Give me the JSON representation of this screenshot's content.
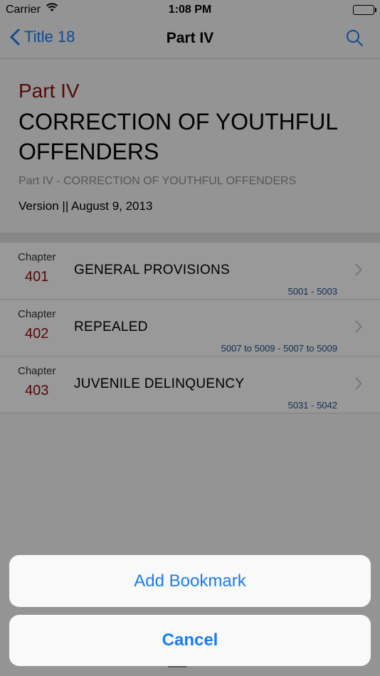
{
  "status_bar": {
    "carrier": "Carrier",
    "time": "1:08 PM"
  },
  "nav": {
    "back_label": "Title 18",
    "title": "Part IV"
  },
  "header": {
    "part": "Part IV",
    "heading": "CORRECTION OF YOUTHFUL OFFENDERS",
    "subtitle": "Part IV - CORRECTION OF YOUTHFUL OFFENDERS",
    "version": "Version || August 9, 2013"
  },
  "chapters": [
    {
      "label": "Chapter",
      "number": "401",
      "title": "GENERAL PROVISIONS",
      "range": "5001 - 5003"
    },
    {
      "label": "Chapter",
      "number": "402",
      "title": "REPEALED",
      "range": "5007 to 5009 - 5007 to 5009"
    },
    {
      "label": "Chapter",
      "number": "403",
      "title": "JUVENILE DELINQUENCY",
      "range": "5031 - 5042"
    }
  ],
  "action_sheet": {
    "add_label": "Add Bookmark",
    "cancel_label": "Cancel"
  },
  "colors": {
    "accent": "#1a7cf5",
    "part_red": "#8b1010",
    "range_blue": "#1f4e8a"
  }
}
